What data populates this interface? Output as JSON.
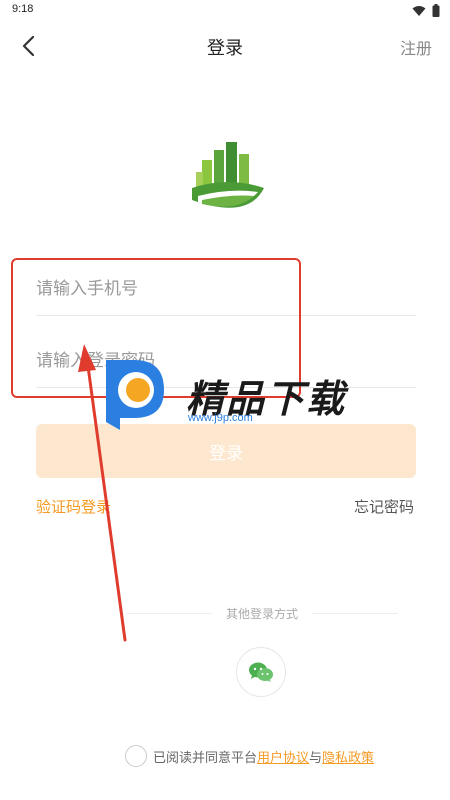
{
  "status_bar": {
    "time": "9:18"
  },
  "header": {
    "title": "登录",
    "register_label": "注册"
  },
  "form": {
    "phone_placeholder": "请输入手机号",
    "password_placeholder": "请输入登录密码",
    "login_label": "登录"
  },
  "links": {
    "sms_login": "验证码登录",
    "forgot_password": "忘记密码"
  },
  "other_login": {
    "title": "其他登录方式",
    "methods": [
      "wechat-icon"
    ]
  },
  "agreement": {
    "prefix": "已阅读并同意平台",
    "user_agreement": "用户协议",
    "and": "与",
    "privacy_policy": "隐私政策"
  },
  "watermark": {
    "name": "精品下载",
    "url": "www.j9p.com"
  },
  "colors": {
    "accent": "#f59a23",
    "login_button_bg": "#fde8cf",
    "highlight": "#e03c2e",
    "logo_green": "#5aa63c"
  }
}
